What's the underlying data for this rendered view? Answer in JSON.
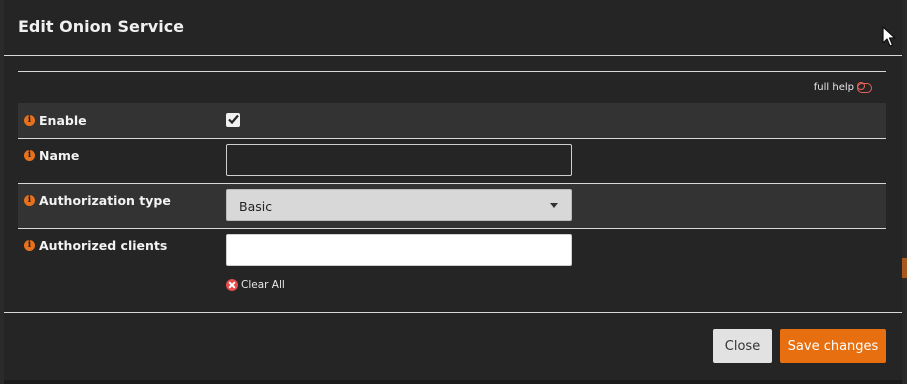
{
  "modal": {
    "title": "Edit Onion Service"
  },
  "help": {
    "label": "full help"
  },
  "fields": {
    "enable": {
      "label": "Enable",
      "checked": true
    },
    "name": {
      "label": "Name",
      "value": ""
    },
    "auth_type": {
      "label": "Authorization type",
      "selected": "Basic"
    },
    "auth_clients": {
      "label": "Authorized clients",
      "value": "",
      "clear_all": "Clear All"
    }
  },
  "footer": {
    "close_label": "Close",
    "save_label": "Save changes"
  },
  "icons": {
    "info": "info-circle-icon",
    "toggle": "toggle-off-icon",
    "clear": "times-circle-icon",
    "cursor": "mouse-pointer-icon"
  },
  "colors": {
    "accent": "#e76f0f",
    "info": "#e8711c",
    "danger": "#e54b4b"
  }
}
